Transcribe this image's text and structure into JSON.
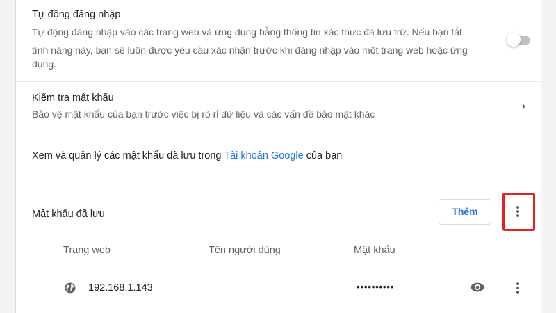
{
  "auto_signin": {
    "title": "Tự động đăng nhập",
    "description_line1": "Tự động đăng nhập vào các trang web và ứng dụng bằng thông tin xác thực đã lưu trữ. Nếu bạn tắt",
    "description_line2": "tính năng này, bạn sẽ luôn được yêu cầu xác nhận trước khi đăng nhập vào một trang web hoặc ứng",
    "description_line3": "dụng.",
    "enabled": false
  },
  "password_check": {
    "title": "Kiểm tra mật khẩu",
    "description": "Bảo vệ mật khẩu của bạn trước việc bị rò rỉ dữ liệu và các vấn đề bảo mật khác",
    "icon": "chevron-right-icon"
  },
  "manage": {
    "prefix": "Xem và quản lý các mật khẩu đã lưu trong ",
    "link_text": "Tài khoản Google",
    "suffix": " của bạn"
  },
  "saved_passwords": {
    "title": "Mật khẩu đã lưu",
    "add_button": "Thêm",
    "more_icon": "more-vert-icon",
    "highlight_color": "#e8201f",
    "columns": [
      "Trang web",
      "Tên người dùng",
      "Mật khẩu"
    ],
    "rows": [
      {
        "site": "192.168.1.143",
        "username": "",
        "password": "••••••••••",
        "site_icon": "globe-icon",
        "show_icon": "eye-icon",
        "more_icon": "more-vert-icon"
      }
    ]
  },
  "colors": {
    "accent": "#1a73e8",
    "text": "#202124",
    "secondary": "#5f6368"
  }
}
